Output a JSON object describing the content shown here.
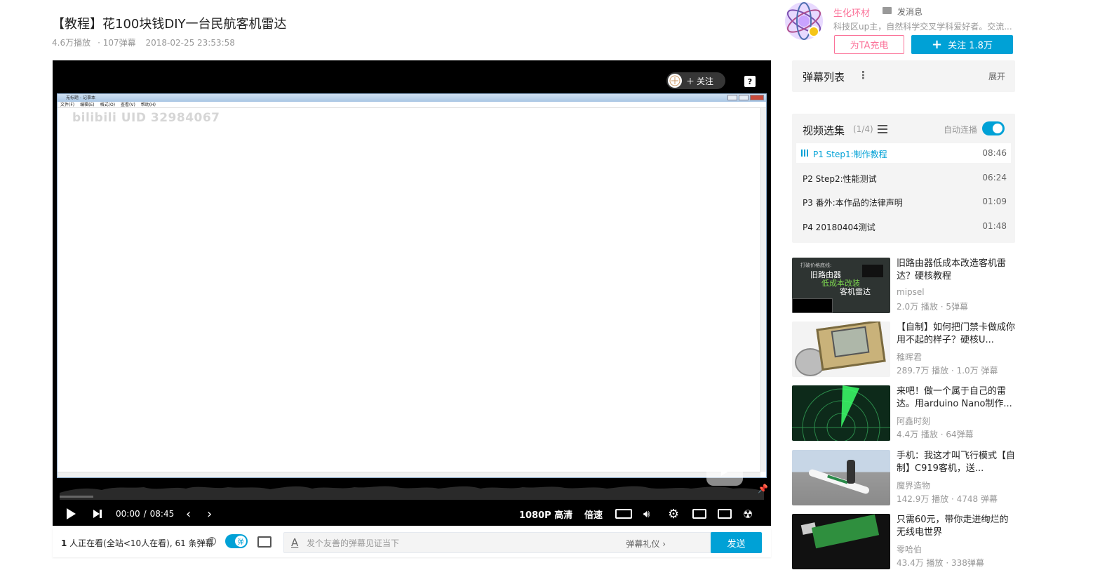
{
  "video": {
    "title": "【教程】花100块钱DIY一台民航客机雷达",
    "plays": "4.6万播放",
    "danmaku": "107弹幕",
    "date": "2018-02-25 23:53:58"
  },
  "player": {
    "follow_label": "关注",
    "notepad_title": "无标题 - 记事本",
    "notepad_menu": [
      "文件(F)",
      "编辑(E)",
      "格式(O)",
      "查看(V)",
      "帮助(H)"
    ],
    "watermark": "bilibili UID 32984067",
    "time_current": "00:00",
    "time_sep": "/",
    "time_total": "08:45",
    "quality": "1080P 高清",
    "speed": "倍速"
  },
  "danmaku_bar": {
    "viewers_num": "1",
    "viewers_text": " 人正在看(全站<10人在看), 61 条弹幕",
    "toggle_label": "弹",
    "input_placeholder": "发个友善的弹幕见证当下",
    "etiquette": "弹幕礼仪 ›",
    "send": "发送"
  },
  "up": {
    "name": "生化环材",
    "message": "发消息",
    "desc": "科技区up主，自然科学交叉学科爱好者。交流...",
    "charge": "为TA充电",
    "follow": "关注 1.8万"
  },
  "danmaku_list": {
    "title": "弹幕列表",
    "more": "⋮",
    "expand": "展开"
  },
  "episodes": {
    "title": "视频选集",
    "count": "(1/4)",
    "autoplay": "自动连播",
    "items": [
      {
        "label": "P1   Step1:制作教程",
        "duration": "08:46"
      },
      {
        "label": "P2   Step2:性能测试",
        "duration": "06:24"
      },
      {
        "label": "P3   番外:本作品的法律声明",
        "duration": "01:09"
      },
      {
        "label": "P4   20180404测试",
        "duration": "01:48"
      }
    ]
  },
  "recommendations": [
    {
      "title": "旧路由器低成本改造客机雷达？硬核教程",
      "author": "mipsel",
      "stats": "2.0万 播放 · 5弹幕",
      "thumb_text": [
        "打破价格底线:",
        "旧路由器",
        "低成本改装",
        "客机雷达"
      ]
    },
    {
      "title": "【自制】如何把门禁卡做成你用不起的样子？硬核U...",
      "author": "稚晖君",
      "stats": "289.7万 播放 · 1.0万 弹幕",
      "thumb_text": []
    },
    {
      "title": "来吧！做一个属于自己的雷达。用arduino Nano制作...",
      "author": "阿鑫时刻",
      "stats": "4.4万 播放 · 64弹幕",
      "thumb_text": []
    },
    {
      "title": "手机：我这才叫飞行模式【自制】C919客机，送...",
      "author": "魔界造物",
      "stats": "142.9万 播放 · 4748 弹幕",
      "thumb_text": []
    },
    {
      "title": "只需60元，带你走进绚烂的无线电世界",
      "author": "零哈伯",
      "stats": "43.4万 播放 · 338弹幕",
      "thumb_text": []
    }
  ],
  "colors": {
    "accent": "#00a1d6",
    "pink": "#fb7299",
    "panel_bg": "#f4f4f4"
  }
}
